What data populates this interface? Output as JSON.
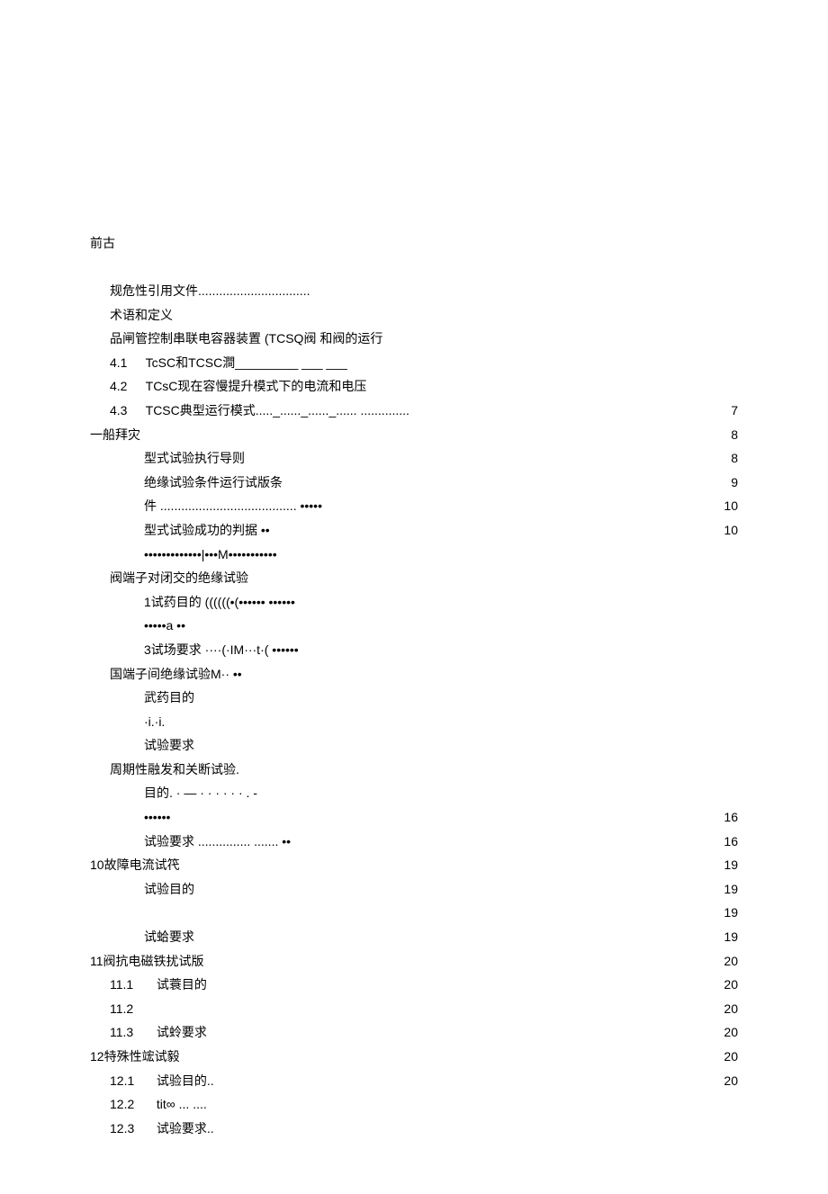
{
  "heading": "前古",
  "lines": [
    {
      "indent": "indent1",
      "text": "规危性引用文件................................",
      "page": ""
    },
    {
      "indent": "indent1",
      "text": "术语和定义",
      "page": ""
    },
    {
      "indent": "indent1",
      "text": "品闸管控制串联电容器装置        (TCSQ阀 和阀的运行",
      "page": ""
    },
    {
      "indent": "indent1",
      "prefix": "4.1",
      "text": "TcSC和TCSC澗_________ ___ ___",
      "page": ""
    },
    {
      "indent": "indent1",
      "prefix": "4.2",
      "text": "TCsC现在容慢提升模式下的电流和电压",
      "page": ""
    },
    {
      "indent": "indent1",
      "prefix": "4.3",
      "text": "TCSC典型运行模式....._......_......_...... ..............",
      "page": "7"
    },
    {
      "indent": "indent0",
      "text": "一船拜灾",
      "page": "8"
    },
    {
      "indent": "indent4",
      "text": "型式试验执行导则",
      "page": "8"
    },
    {
      "indent": "indent4",
      "text": "绝缘试验条件运行试版条",
      "page": "9"
    },
    {
      "indent": "indent4",
      "text": "件 .......................................                    •••••",
      "page": "10"
    },
    {
      "indent": "indent4",
      "text": " 型式试验成功的判据               ••",
      "page": "10"
    },
    {
      "indent": "indent4",
      "text": "•••••••••••••|•••M•••••••••••",
      "page": ""
    },
    {
      "indent": "indent1",
      "text": "阀端子对闭交的绝缘试验",
      "page": ""
    },
    {
      "indent": "indent4",
      "text": "1试药目的     ((((((•(••••••         ••••••",
      "page": ""
    },
    {
      "indent": "indent4",
      "text": "                       •••••a                    ••",
      "page": ""
    },
    {
      "indent": "indent4",
      "text": "3试场要求     ····(·IM···t·(           ••••••",
      "page": ""
    },
    {
      "indent": "indent1",
      "text": "  国端子间绝缘试验M··                         ••",
      "page": ""
    },
    {
      "indent": "indent4",
      "text": "  武药目的",
      "page": ""
    },
    {
      "indent": "indent4",
      "text": "        ·i.·i.",
      "page": ""
    },
    {
      "indent": "indent4",
      "text": "  试验要求",
      "page": ""
    },
    {
      "indent": "indent1",
      "text": "  周期性融发和关断试验.",
      "page": ""
    },
    {
      "indent": "indent4",
      "text": "    目的. · — · · · · · · . -",
      "page": ""
    },
    {
      "indent": "indent4",
      "text": "                                                          ••••••",
      "page": "16"
    },
    {
      "indent": "indent4",
      "text": "  试验要求 ............... .......               ••",
      "page": "16"
    },
    {
      "indent": "indent0",
      "text": "10故障电流试笩",
      "page": "19"
    },
    {
      "indent": "indent4",
      "text": "  试验目的",
      "page": "19"
    },
    {
      "indent": "indent4",
      "text": "",
      "page": "19"
    },
    {
      "indent": "indent4",
      "text": "  试蛤要求",
      "page": "19"
    },
    {
      "indent": "indent0",
      "text": "11阀抗电磁铁扰试版",
      "page": "20"
    },
    {
      "indent": "indent1",
      "prefix": "11.1",
      "text": "试蓑目的",
      "page": "20"
    },
    {
      "indent": "indent1",
      "prefix": "11.2",
      "text": "",
      "page": "20"
    },
    {
      "indent": "indent1",
      "prefix": "11.3",
      "text": "试蛉要求",
      "page": "20"
    },
    {
      "indent": "indent0",
      "text": "12特殊性竤试毅",
      "page": "20"
    },
    {
      "indent": "indent1",
      "prefix": "12.1",
      "text": "试验目的..",
      "page": "20"
    },
    {
      "indent": "indent1",
      "prefix": "12.2",
      "text": "tit∞  ...  ....",
      "page": ""
    },
    {
      "indent": "indent1",
      "prefix": "12.3",
      "text": "试验要求..",
      "page": ""
    }
  ]
}
